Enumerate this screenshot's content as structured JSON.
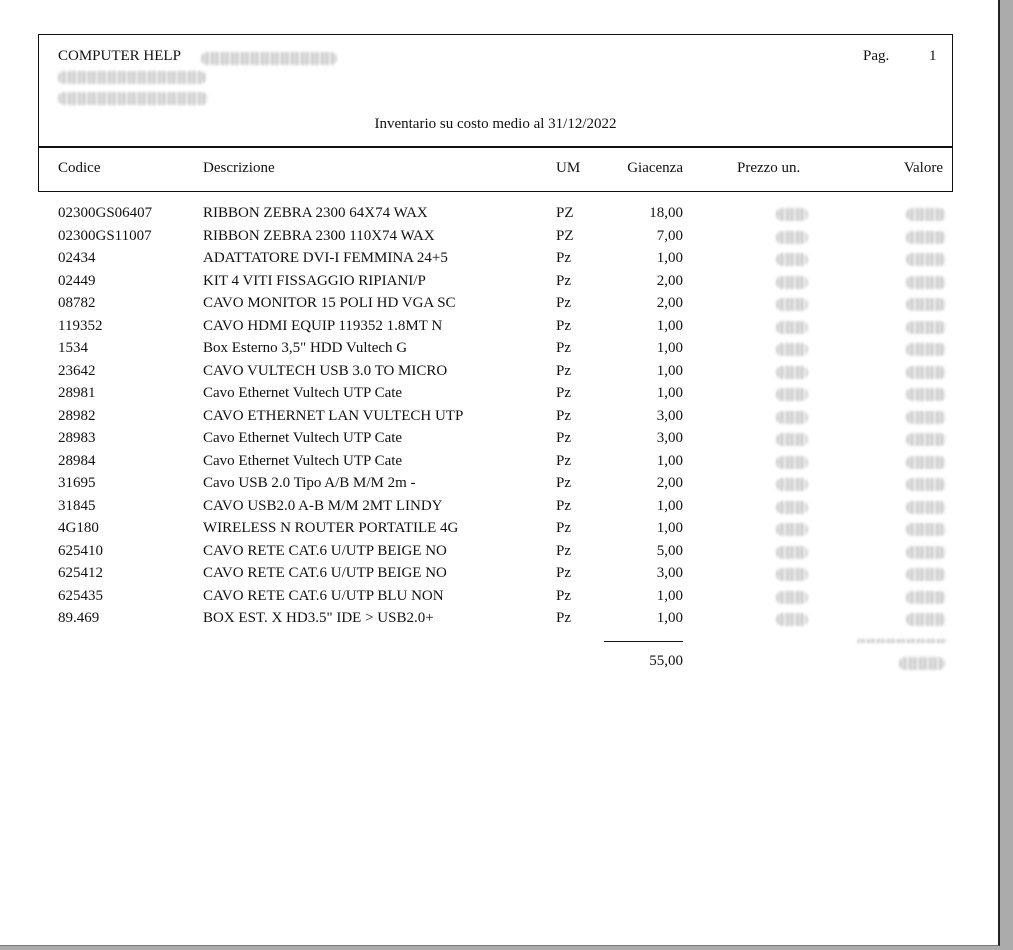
{
  "header": {
    "company": "COMPUTER HELP",
    "page_label": "Pag.",
    "page_number": "1",
    "title": "Inventario su costo medio al 31/12/2022"
  },
  "columns": {
    "code": "Codice",
    "description": "Descrizione",
    "um": "UM",
    "quantity": "Giacenza",
    "unit_price": "Prezzo un.",
    "value": "Valore"
  },
  "items": [
    {
      "code": "02300GS06407",
      "description": "RIBBON ZEBRA 2300 64X74 WAX",
      "um": "PZ",
      "quantity": "18,00"
    },
    {
      "code": "02300GS11007",
      "description": "RIBBON ZEBRA 2300 110X74 WAX",
      "um": "PZ",
      "quantity": "7,00"
    },
    {
      "code": "02434",
      "description": "ADATTATORE DVI-I FEMMINA 24+5",
      "um": "Pz",
      "quantity": "1,00"
    },
    {
      "code": "02449",
      "description": "KIT 4 VITI FISSAGGIO RIPIANI/P",
      "um": "Pz",
      "quantity": "2,00"
    },
    {
      "code": "08782",
      "description": "CAVO MONITOR 15 POLI HD VGA SC",
      "um": "Pz",
      "quantity": "2,00"
    },
    {
      "code": "119352",
      "description": "CAVO HDMI EQUIP 119352 1.8MT N",
      "um": "Pz",
      "quantity": "1,00"
    },
    {
      "code": "1534",
      "description": "Box Esterno 3,5\" HDD Vultech G",
      "um": "Pz",
      "quantity": "1,00"
    },
    {
      "code": "23642",
      "description": "CAVO VULTECH USB 3.0 TO MICRO",
      "um": "Pz",
      "quantity": "1,00"
    },
    {
      "code": "28981",
      "description": "Cavo Ethernet Vultech UTP Cate",
      "um": "Pz",
      "quantity": "1,00"
    },
    {
      "code": "28982",
      "description": "CAVO ETHERNET LAN VULTECH UTP",
      "um": "Pz",
      "quantity": "3,00"
    },
    {
      "code": "28983",
      "description": "Cavo Ethernet Vultech UTP Cate",
      "um": "Pz",
      "quantity": "3,00"
    },
    {
      "code": "28984",
      "description": "Cavo Ethernet Vultech UTP Cate",
      "um": "Pz",
      "quantity": "1,00"
    },
    {
      "code": "31695",
      "description": "Cavo USB 2.0 Tipo A/B M/M 2m -",
      "um": "Pz",
      "quantity": "2,00"
    },
    {
      "code": "31845",
      "description": "CAVO USB2.0 A-B M/M 2MT LINDY",
      "um": "Pz",
      "quantity": "1,00"
    },
    {
      "code": "4G180",
      "description": "WIRELESS N ROUTER PORTATILE 4G",
      "um": "Pz",
      "quantity": "1,00"
    },
    {
      "code": "625410",
      "description": "CAVO RETE CAT.6 U/UTP BEIGE NO",
      "um": "Pz",
      "quantity": "5,00"
    },
    {
      "code": "625412",
      "description": "CAVO RETE CAT.6 U/UTP BEIGE NO",
      "um": "Pz",
      "quantity": "3,00"
    },
    {
      "code": "625435",
      "description": "CAVO RETE CAT.6 U/UTP BLU NON",
      "um": "Pz",
      "quantity": "1,00"
    },
    {
      "code": "89.469",
      "description": "BOX EST. X HD3.5\" IDE > USB2.0+",
      "um": "Pz",
      "quantity": "1,00"
    }
  ],
  "totals": {
    "quantity": "55,00"
  }
}
